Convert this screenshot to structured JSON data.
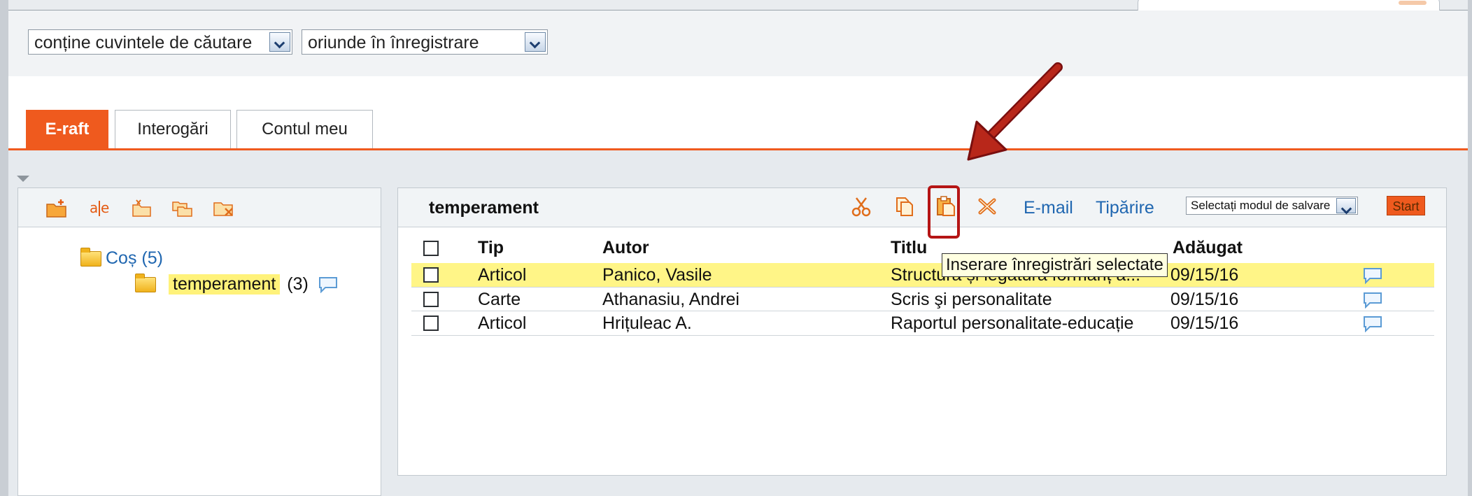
{
  "search": {
    "condition_select": "conține cuvintele de căutare",
    "scope_select": "oriunde în înregistrare"
  },
  "tabs": [
    {
      "label": "E-raft",
      "active": true
    },
    {
      "label": "Interogări",
      "active": false
    },
    {
      "label": "Contul meu",
      "active": false
    }
  ],
  "tree": {
    "root_label": "Coș (5)",
    "child_label": "temperament",
    "child_count": "(3)"
  },
  "results": {
    "folder_title": "temperament",
    "email_label": "E-mail",
    "print_label": "Tipărire",
    "save_mode_select": "Selectați modul de salvare",
    "start_button": "Start",
    "tooltip": "Inserare înregistrări selectate",
    "columns": {
      "tip": "Tip",
      "autor": "Autor",
      "titlu": "Titlu",
      "adaugat": "Adăugat"
    },
    "rows": [
      {
        "tip": "Articol",
        "autor": "Panico, Vasile",
        "titlu": "Structura și legătură formanț a...",
        "adaugat": "09/15/16"
      },
      {
        "tip": "Carte",
        "autor": "Athanasiu, Andrei",
        "titlu": "Scris şi personalitate",
        "adaugat": "09/15/16"
      },
      {
        "tip": "Articol",
        "autor": "Hrițuleac A.",
        "titlu": "Raportul personalitate-educație",
        "adaugat": "09/15/16"
      }
    ]
  },
  "colors": {
    "accent": "#ef5a1e",
    "highlight": "#fff587",
    "link": "#1f66b0",
    "annotation": "#b51515"
  }
}
